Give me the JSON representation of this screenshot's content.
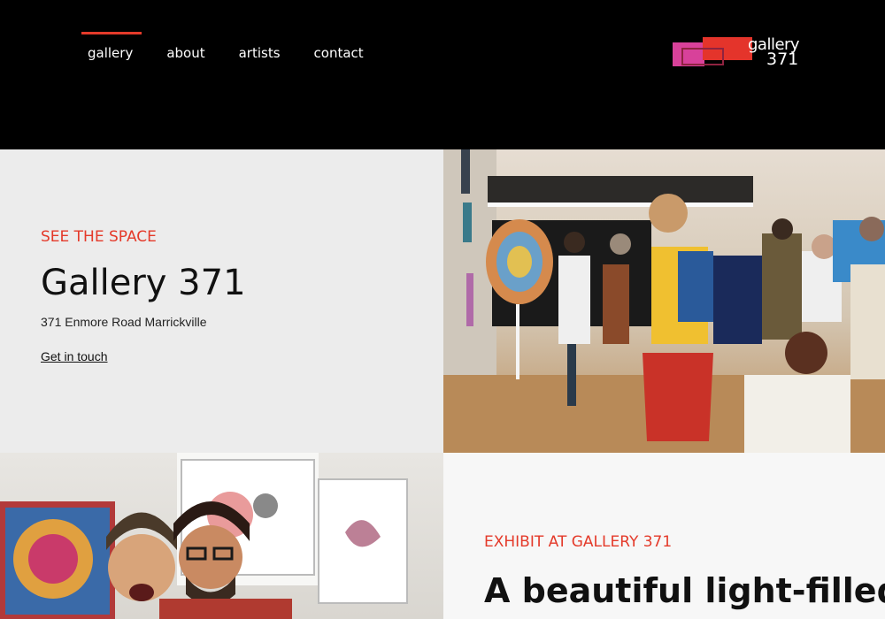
{
  "nav": {
    "items": [
      {
        "label": "gallery",
        "active": true
      },
      {
        "label": "about",
        "active": false
      },
      {
        "label": "artists",
        "active": false
      },
      {
        "label": "contact",
        "active": false
      }
    ]
  },
  "logo": {
    "line1": "gallery",
    "line2": "371"
  },
  "colors": {
    "accent": "#e43a2a",
    "header_bg": "#000000",
    "logo_pink": "#d8419a"
  },
  "hero": {
    "eyebrow": "SEE THE SPACE",
    "title": "Gallery 371",
    "address": "371 Enmore Road Marrickville",
    "link": "Get in touch"
  },
  "exhibit": {
    "eyebrow": "EXHIBIT AT GALLERY 371",
    "title": "A beautiful light-filled"
  }
}
